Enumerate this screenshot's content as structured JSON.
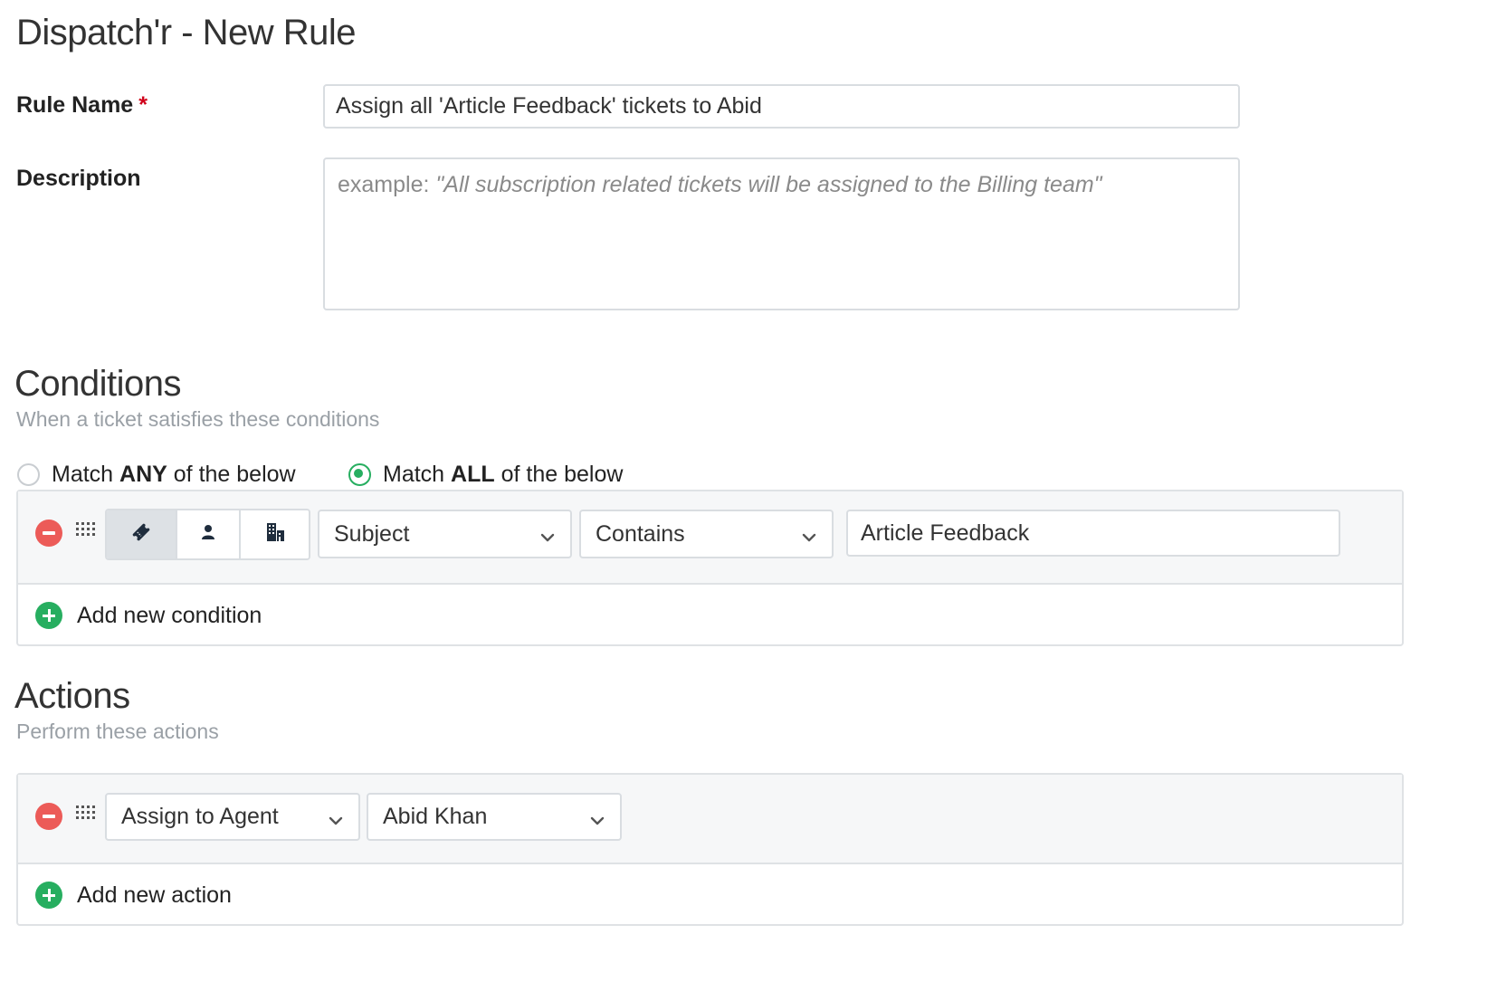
{
  "page": {
    "title": "Dispatch'r - New Rule"
  },
  "form": {
    "rule_name_label": "Rule Name",
    "required_mark": "*",
    "rule_name_value": "Assign all 'Article Feedback' tickets to Abid",
    "description_label": "Description",
    "description_placeholder_prefix": "example: ",
    "description_placeholder_quote": "\"All subscription related tickets will be assigned to the Billing team\""
  },
  "conditions": {
    "title": "Conditions",
    "subtitle": "When a ticket satisfies these conditions",
    "match_any": {
      "prefix": "Match ",
      "bold": "ANY",
      "suffix": " of the below",
      "selected": false
    },
    "match_all": {
      "prefix": "Match ",
      "bold": "ALL",
      "suffix": " of the below",
      "selected": true
    },
    "row": {
      "type_options": [
        {
          "icon": "ticket-icon",
          "active": true
        },
        {
          "icon": "user-icon",
          "active": false
        },
        {
          "icon": "company-icon",
          "active": false
        }
      ],
      "field": "Subject",
      "operator": "Contains",
      "value": "Article Feedback"
    },
    "add_label": "Add new condition"
  },
  "actions": {
    "title": "Actions",
    "subtitle": "Perform these actions",
    "row": {
      "action": "Assign to Agent",
      "target": "Abid Khan"
    },
    "add_label": "Add new action"
  },
  "colors": {
    "accent_green": "#27ae60",
    "remove_red": "#ec5b58",
    "required_red": "#d0021b"
  }
}
